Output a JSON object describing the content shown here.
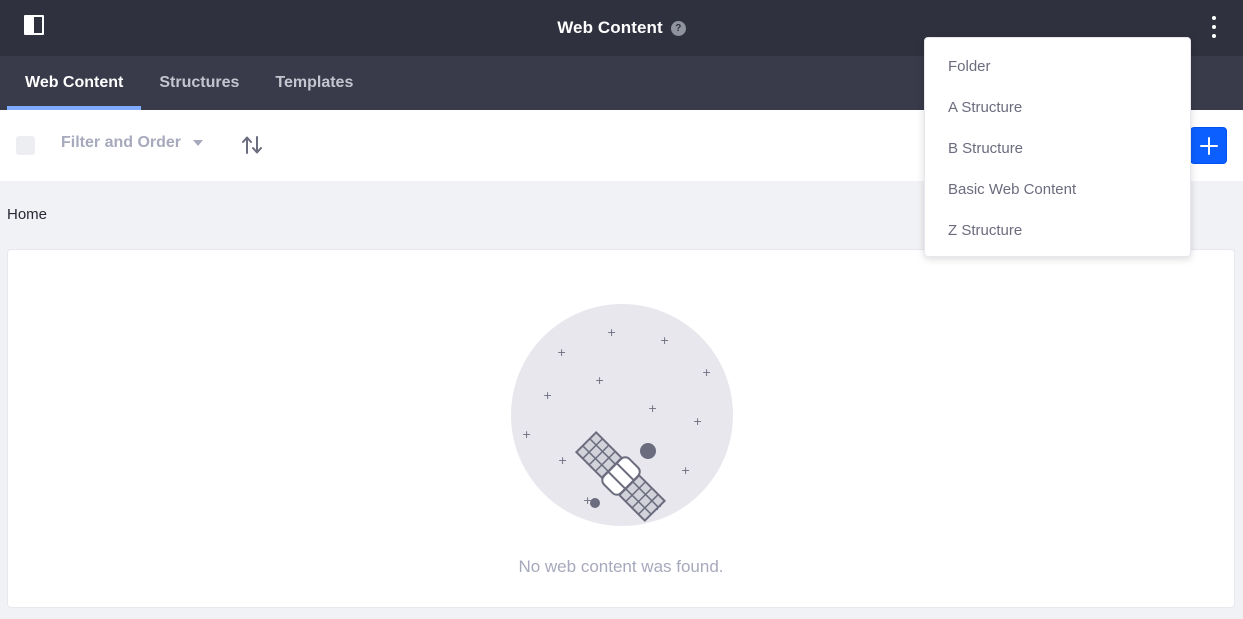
{
  "header": {
    "title": "Web Content",
    "help_glyph": "?",
    "left_icon": "panel-toggle-icon",
    "right_icon": "kebab-icon"
  },
  "nav": {
    "tabs": [
      {
        "label": "Web Content",
        "active": true
      },
      {
        "label": "Structures",
        "active": false
      },
      {
        "label": "Templates",
        "active": false
      }
    ]
  },
  "toolbar": {
    "filter_label": "Filter and Order",
    "sort_icon": "sort-icon",
    "add_icon": "plus-icon"
  },
  "breadcrumb": {
    "label": "Home"
  },
  "empty_state": {
    "message": "No web content was found.",
    "illustration": "satellite-icon"
  },
  "dropdown": {
    "items": [
      "Folder",
      "A Structure",
      "B Structure",
      "Basic Web Content",
      "Z Structure"
    ]
  },
  "colors": {
    "topbar": "#30313f",
    "navbar": "#393a4a",
    "active_tab_indicator": "#80acff",
    "primary_button": "#0b5fff",
    "background": "#f1f2f5"
  }
}
